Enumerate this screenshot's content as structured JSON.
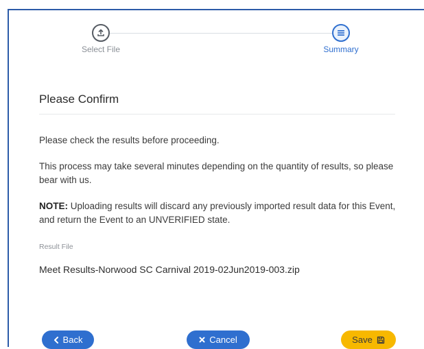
{
  "stepper": {
    "steps": [
      {
        "label": "Select File",
        "icon": "upload-icon",
        "state": "done"
      },
      {
        "label": "Summary",
        "icon": "list-icon",
        "state": "active"
      }
    ]
  },
  "content": {
    "title": "Please Confirm",
    "intro": "Please check the results before proceeding.",
    "process_note": "This process may take several minutes depending on the quantity of results, so please bear with us.",
    "note_label": "NOTE:",
    "note_text": " Uploading results will discard any previously imported result data for this Event, and return the Event to an UNVERIFIED state.",
    "result_file_label": "Result File",
    "result_file_value": "Meet Results-Norwood SC Carnival 2019-02Jun2019-003.zip"
  },
  "buttons": {
    "back_label": "Back",
    "cancel_label": "Cancel",
    "save_label": "Save"
  },
  "colors": {
    "primary": "#2f6fcf",
    "accent": "#f7b800",
    "frame_border": "#2b5aa8"
  }
}
